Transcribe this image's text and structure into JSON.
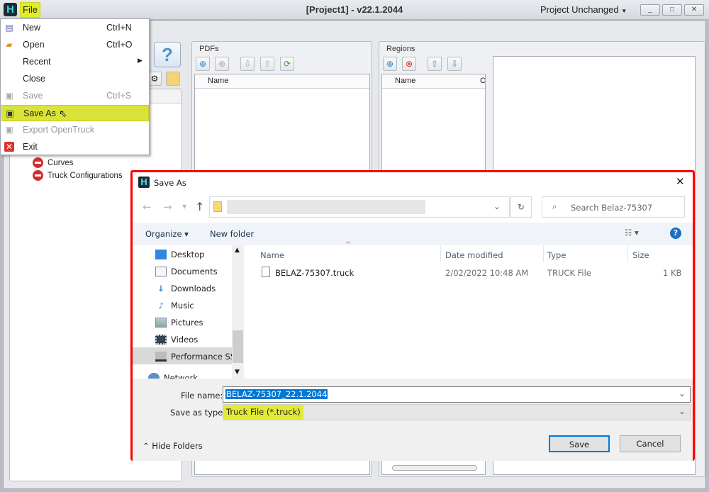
{
  "titlebar": {
    "logo": "H",
    "file_menu": "File",
    "title": "[Project1] -  v22.1.2044",
    "project_state": "Project Unchanged",
    "minimize": "_",
    "maximize": "□",
    "close": "✕"
  },
  "file_menu": {
    "items": [
      {
        "label": "New",
        "shortcut": "Ctrl+N",
        "icon": "document-icon",
        "enabled": true
      },
      {
        "label": "Open",
        "shortcut": "Ctrl+O",
        "icon": "folder-open-icon",
        "enabled": true
      },
      {
        "label": "Recent",
        "shortcut": "",
        "icon": "",
        "enabled": true,
        "submenu": true
      },
      {
        "label": "Close",
        "shortcut": "",
        "icon": "",
        "enabled": true
      },
      {
        "label": "Save",
        "shortcut": "Ctrl+S",
        "icon": "floppy-icon",
        "enabled": false
      },
      {
        "label": "Save As",
        "shortcut": "",
        "icon": "floppy-icon",
        "enabled": true,
        "highlighted": true
      },
      {
        "label": "Export OpenTruck",
        "shortcut": "",
        "icon": "floppy-icon",
        "enabled": false
      },
      {
        "label": "Exit",
        "shortcut": "",
        "icon": "exit-icon",
        "enabled": true
      }
    ]
  },
  "left_tree": {
    "items": [
      "Curves",
      "Truck Configurations"
    ]
  },
  "help_button": "?",
  "pdfs_panel": {
    "title": "PDFs",
    "columns": [
      "Name"
    ]
  },
  "regions_panel": {
    "title": "Regions",
    "columns": [
      "Name",
      "C"
    ]
  },
  "dialog": {
    "title": "Save As",
    "close": "✕",
    "search_placeholder": "Search Belaz-75307",
    "organize": "Organize ▾",
    "new_folder": "New folder",
    "help": "?",
    "nav_items": [
      "Desktop",
      "Documents",
      "Downloads",
      "Music",
      "Pictures",
      "Videos",
      "Performance SSD",
      "Network"
    ],
    "columns": [
      "Name",
      "Date modified",
      "Type",
      "Size"
    ],
    "files": [
      {
        "name": "BELAZ-75307.truck",
        "date": "2/02/2022 10:48 AM",
        "type": "TRUCK File",
        "size": "1 KB"
      }
    ],
    "file_name_label": "File name:",
    "file_name": "BELAZ-75307_22.1.2044",
    "save_type_label": "Save as type:",
    "save_type": "Truck File (*.truck)",
    "hide_folders": "Hide Folders",
    "save": "Save",
    "cancel": "Cancel"
  },
  "colors": {
    "highlight": "#d9e43a",
    "dialog_border": "#ff0000",
    "accent": "#0078d7"
  }
}
